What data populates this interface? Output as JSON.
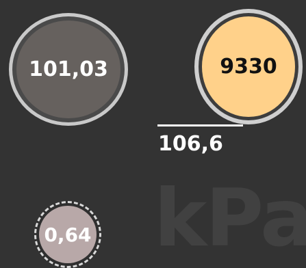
{
  "unit": "kPa",
  "gauges": [
    {
      "value": "101,03"
    },
    {
      "value": "9330"
    },
    {
      "value": "0,64"
    }
  ],
  "reading": {
    "value": "106,6"
  },
  "colors": {
    "background": "#333333",
    "gauge_1_fill": "#66615e",
    "gauge_2_fill": "#ffd18a",
    "gauge_3_fill": "#b8a8a8",
    "ring": "#cfcfcf",
    "text_light": "#ffffff",
    "text_dark": "#111111"
  }
}
